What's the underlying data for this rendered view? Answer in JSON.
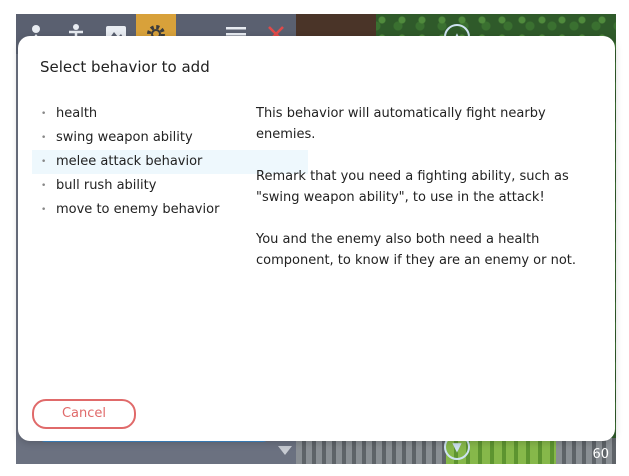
{
  "dialog": {
    "title": "Select behavior to add",
    "behaviors": [
      {
        "label": "health",
        "selected": false
      },
      {
        "label": "swing weapon ability",
        "selected": false
      },
      {
        "label": "melee attack behavior",
        "selected": true
      },
      {
        "label": "bull rush ability",
        "selected": false
      },
      {
        "label": "move to enemy behavior",
        "selected": false
      }
    ],
    "description": [
      "This behavior will automatically fight nearby enemies.",
      "Remark that you need a fighting ability, such as \"swing weapon ability\", to use in the attack!",
      "You and the enemy also both need a health component, to know if they are an enemy or not."
    ],
    "cancel_label": "Cancel"
  },
  "status": {
    "fps": "60"
  },
  "colors": {
    "toolbar": "#5a6070",
    "active_tool": "#d8a13a",
    "close": "#e04a4a",
    "selection": "#eef8fd",
    "cancel": "#e06a6a"
  },
  "toolbar_icons": [
    "person-pin-icon",
    "figure-icon",
    "image-icon",
    "gear-icon",
    "menu-icon",
    "close-icon"
  ]
}
